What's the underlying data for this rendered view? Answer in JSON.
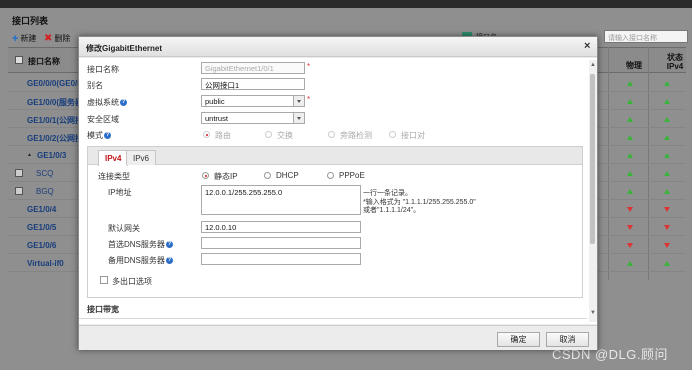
{
  "panel": {
    "title": "接口列表"
  },
  "toolbar": {
    "new_label": "新建",
    "delete_label": "删除"
  },
  "search": {
    "placeholder": "请输入接口名称",
    "field_label": "接口名称"
  },
  "grid": {
    "header_name": "接口名称",
    "header_physical": "物理",
    "header_status": "状态 IPv4",
    "rows": [
      {
        "name": "GE0/0/0(GE0/M",
        "checkbox": false,
        "physical": "up",
        "ipv4": "up"
      },
      {
        "name": "GE1/0/0(服务器",
        "checkbox": false,
        "physical": "up",
        "ipv4": "up"
      },
      {
        "name": "GE1/0/1(公网接",
        "checkbox": false,
        "physical": "up",
        "ipv4": "up"
      },
      {
        "name": "GE1/0/2(公网接",
        "checkbox": false,
        "physical": "up",
        "ipv4": "up"
      },
      {
        "name": "GE1/0/3",
        "checkbox": false,
        "expand": "▲",
        "physical": "up",
        "ipv4": "up"
      },
      {
        "name": "SCQ",
        "checkbox": true,
        "physical": "up",
        "ipv4": "up"
      },
      {
        "name": "BGQ",
        "checkbox": true,
        "physical": "up",
        "ipv4": "up"
      },
      {
        "name": "GE1/0/4",
        "checkbox": false,
        "physical": "down",
        "ipv4": "down"
      },
      {
        "name": "GE1/0/5",
        "checkbox": false,
        "physical": "down",
        "ipv4": "down"
      },
      {
        "name": "GE1/0/6",
        "checkbox": false,
        "physical": "down",
        "ipv4": "down"
      },
      {
        "name": "Virtual-if0",
        "checkbox": false,
        "physical": "up",
        "ipv4": "up"
      }
    ]
  },
  "modal": {
    "title": "修改GigabitEthernet",
    "close": "×",
    "iface_name_label": "接口名称",
    "iface_name_value": "GigabitEthernet1/0/1",
    "alias_label": "别名",
    "alias_value": "公网接口1",
    "vsys_label": "虚拟系统",
    "vsys_value": "public",
    "zone_label": "安全区域",
    "zone_value": "untrust",
    "mode_label": "模式",
    "mode_options": [
      "路由",
      "交换",
      "旁路检测",
      "接口对"
    ],
    "tabs": [
      "IPv4",
      "IPv6"
    ],
    "conn_type_label": "连接类型",
    "conn_options": [
      "静态IP",
      "DHCP",
      "PPPoE"
    ],
    "ip_label": "IP地址",
    "ip_value": "12.0.0.1/255.255.255.0",
    "ip_hint_1": "一行一条记录。",
    "ip_hint_2": "*输入格式为 \"1.1.1.1/255.255.255.0\"",
    "ip_hint_3": "或者\"1.1.1.1/24\"。",
    "gateway_label": "默认网关",
    "gateway_value": "12.0.0.10",
    "dns1_label": "首选DNS服务器",
    "dns2_label": "备用DNS服务器",
    "multi_exit_label": "多出口选项",
    "bandwidth_section": "接口带宽",
    "ok_label": "确定",
    "cancel_label": "取消"
  },
  "watermark": "CSDN @DLG.顾问",
  "colors": {
    "up": "#3bb33b",
    "down": "#dd3333",
    "active_tab": "#c01818",
    "link": "#183e7c"
  }
}
